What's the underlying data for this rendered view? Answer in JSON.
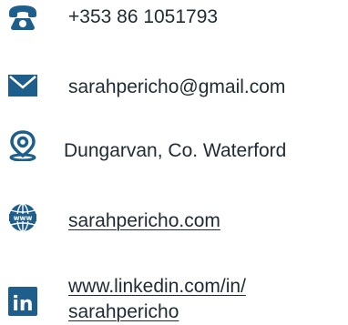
{
  "contact": {
    "phone": {
      "icon": "telephone-icon",
      "text": "+353 86 1051793"
    },
    "email": {
      "icon": "envelope-icon",
      "text": "sarahpericho@gmail.com"
    },
    "location": {
      "icon": "map-pin-icon",
      "text": "Dungarvan, Co. Waterford"
    },
    "website": {
      "icon": "globe-www-icon",
      "text": "sarahpericho.com"
    },
    "linkedin": {
      "icon": "linkedin-icon",
      "line1": "www.linkedin.com/in/",
      "line2": "sarahpericho",
      "logo_text": "in"
    }
  },
  "colors": {
    "icon": "#1e5e8c",
    "text": "#1f2a33"
  }
}
